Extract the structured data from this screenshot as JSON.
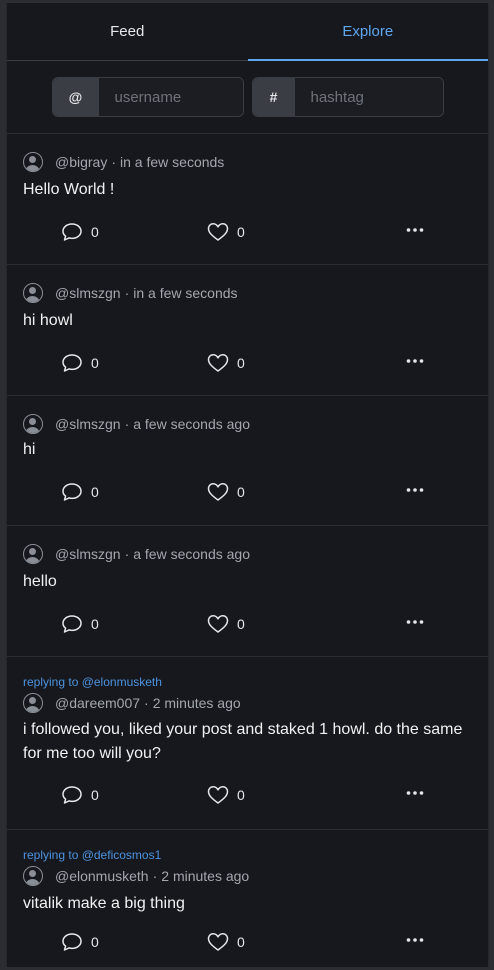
{
  "tabs": [
    {
      "label": "Feed",
      "active": false
    },
    {
      "label": "Explore",
      "active": true
    }
  ],
  "search": {
    "username_addon": "@",
    "username_placeholder": "username",
    "hashtag_addon": "#",
    "hashtag_placeholder": "hashtag"
  },
  "posts": [
    {
      "reply_to": "",
      "handle": "@bigray",
      "time": "in a few seconds",
      "content": "Hello World !",
      "comments": "0",
      "likes": "0"
    },
    {
      "reply_to": "",
      "handle": "@slmszgn",
      "time": "in a few seconds",
      "content": "hi howl",
      "comments": "0",
      "likes": "0"
    },
    {
      "reply_to": "",
      "handle": "@slmszgn",
      "time": "a few seconds ago",
      "content": "hi",
      "comments": "0",
      "likes": "0"
    },
    {
      "reply_to": "",
      "handle": "@slmszgn",
      "time": "a few seconds ago",
      "content": "hello",
      "comments": "0",
      "likes": "0"
    },
    {
      "reply_to": "replying to @elonmusketh",
      "handle": "@dareem007",
      "time": "2 minutes ago",
      "content": "i followed you, liked your post and staked 1 howl. do the same for me too will you?",
      "comments": "0",
      "likes": "0"
    },
    {
      "reply_to": "replying to @deficosmos1",
      "handle": "@elonmusketh",
      "time": "2 minutes ago",
      "content": "vitalik make a big thing",
      "comments": "0",
      "likes": "0"
    }
  ],
  "meta_separator": "·",
  "colors": {
    "accent": "#5ea6f0",
    "reply_link": "#4d93e0",
    "background": "#16181d"
  },
  "icons": {
    "comment": "comment-icon",
    "like": "heart-icon",
    "more": "more-icon",
    "avatar": "user-avatar-icon"
  }
}
